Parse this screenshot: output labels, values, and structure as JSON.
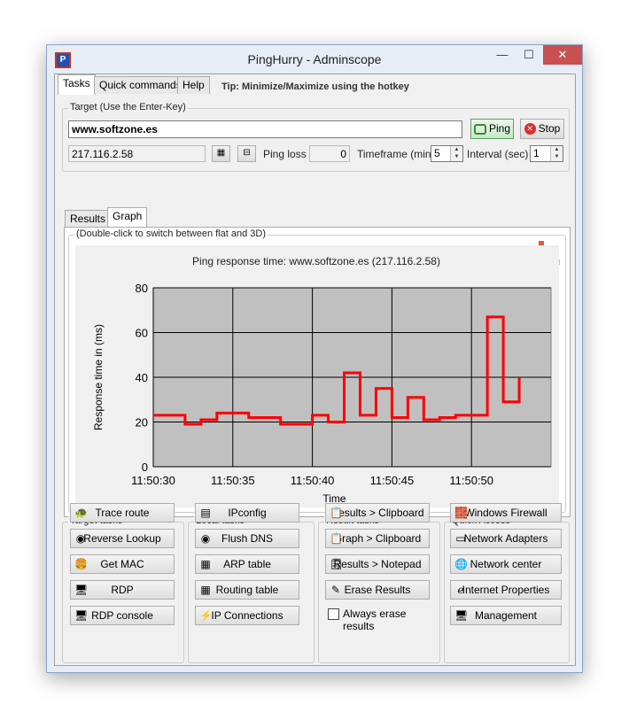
{
  "window": {
    "title": "PingHurry - Adminscope",
    "icon_letter": "P",
    "minimize": "—",
    "maximize": "☐",
    "close": "✕"
  },
  "tabs": [
    {
      "label": "Tasks"
    },
    {
      "label": "Quick commands"
    },
    {
      "label": "Help"
    }
  ],
  "tip": "Tip: Minimize/Maximize using the hotkey",
  "target": {
    "group_label": "Target (Use the Enter-Key)",
    "host": "www.softzone.es",
    "ip": "217.116.2.58",
    "ping_button": "Ping",
    "stop_button": "Stop",
    "ping_loss_label": "Ping loss",
    "ping_loss": "0",
    "timeframe_label": "Timeframe (min)",
    "timeframe": "5",
    "interval_label": "Interval (sec)",
    "interval": "1"
  },
  "subtabs": [
    {
      "label": "Results"
    },
    {
      "label": "Graph"
    }
  ],
  "graph_hint": "(Double-click to switch between flat and 3D)",
  "chart_data": {
    "type": "line",
    "title": "Ping response time: www.softzone.es (217.116.2.58)",
    "xlabel": "Time",
    "ylabel": "Response time in (ms)",
    "ylim": [
      0,
      80
    ],
    "yticks": [
      "0",
      "20",
      "40",
      "60",
      "80"
    ],
    "xticks": [
      "11:50:30",
      "11:50:35",
      "11:50:40",
      "11:50:45",
      "11:50:50"
    ],
    "x_start_label": "11:50:30",
    "series": [
      {
        "color": "#ff0000",
        "x": [
          "11:50:30",
          "11:50:32",
          "11:50:33",
          "11:50:34",
          "11:50:36",
          "11:50:38",
          "11:50:40",
          "11:50:41",
          "11:50:42",
          "11:50:43",
          "11:50:44",
          "11:50:45",
          "11:50:46",
          "11:50:47",
          "11:50:48",
          "11:50:49",
          "11:50:50",
          "11:50:51",
          "11:50:52",
          "11:50:53"
        ],
        "values": [
          23,
          19,
          21,
          24,
          22,
          19,
          23,
          20,
          42,
          23,
          35,
          22,
          31,
          21,
          22,
          23,
          23,
          67,
          29,
          40
        ]
      }
    ],
    "grid": true
  },
  "target_tasks": {
    "label": "Target tasks",
    "items": [
      "Trace route",
      "Reverse Lookup",
      "Get MAC",
      "RDP",
      "RDP console"
    ]
  },
  "local_tasks": {
    "label": "Local tasks",
    "items": [
      "IPconfig",
      "Flush DNS",
      "ARP table",
      "Routing table",
      "IP Connections"
    ]
  },
  "result_tasks": {
    "label": "Result tasks",
    "items": [
      "Results > Clipboard",
      "Graph > Clipboard",
      "Results > Notepad",
      "Erase Results"
    ],
    "checkbox": "Always erase results"
  },
  "quick_access": {
    "label": "Quick Access",
    "items": [
      "Windows Firewall",
      "Network Adapters",
      "Network center",
      "Internet Properties",
      "Management"
    ]
  }
}
